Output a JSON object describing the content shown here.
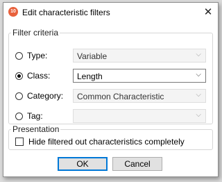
{
  "window": {
    "title": "Edit characteristic filters",
    "app_icon_text": "10",
    "close_glyph": "✕"
  },
  "filter_criteria": {
    "legend": "Filter criteria",
    "rows": [
      {
        "label": "Type:",
        "value": "Variable",
        "selected": false,
        "enabled": false
      },
      {
        "label": "Class:",
        "value": "Length",
        "selected": true,
        "enabled": true
      },
      {
        "label": "Category:",
        "value": "Common Characteristic",
        "selected": false,
        "enabled": false
      },
      {
        "label": "Tag:",
        "value": "",
        "selected": false,
        "enabled": false
      }
    ],
    "dropdown_glyph": "⌵"
  },
  "presentation": {
    "legend": "Presentation",
    "hide_filtered_label": "Hide filtered out characteristics completely",
    "hide_filtered_checked": false
  },
  "buttons": {
    "ok": "OK",
    "cancel": "Cancel"
  },
  "colors": {
    "accent": "#0078d7",
    "app_icon": "#e8613c"
  }
}
